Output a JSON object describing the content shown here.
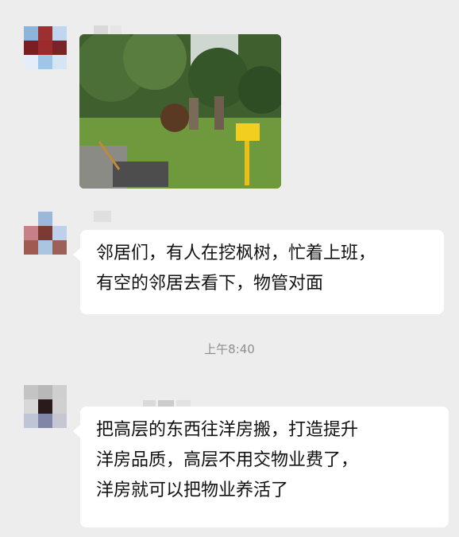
{
  "messages": [
    {
      "type": "image",
      "description_icon": "photo"
    },
    {
      "type": "text",
      "lines": [
        "邻居们，有人在挖枫树，忙着上班，",
        "有空的邻居去看下，物管对面"
      ]
    },
    {
      "type": "text",
      "lines": [
        "把高层的东西往洋房搬，打造提升",
        "洋房品质，高层不用交物业费了，",
        "洋房就可以把物业养活了"
      ]
    }
  ],
  "timestamp": "上午8:40",
  "colors": {
    "background": "#ededed",
    "bubble": "#ffffff",
    "timestamp": "#8d8d8d"
  }
}
